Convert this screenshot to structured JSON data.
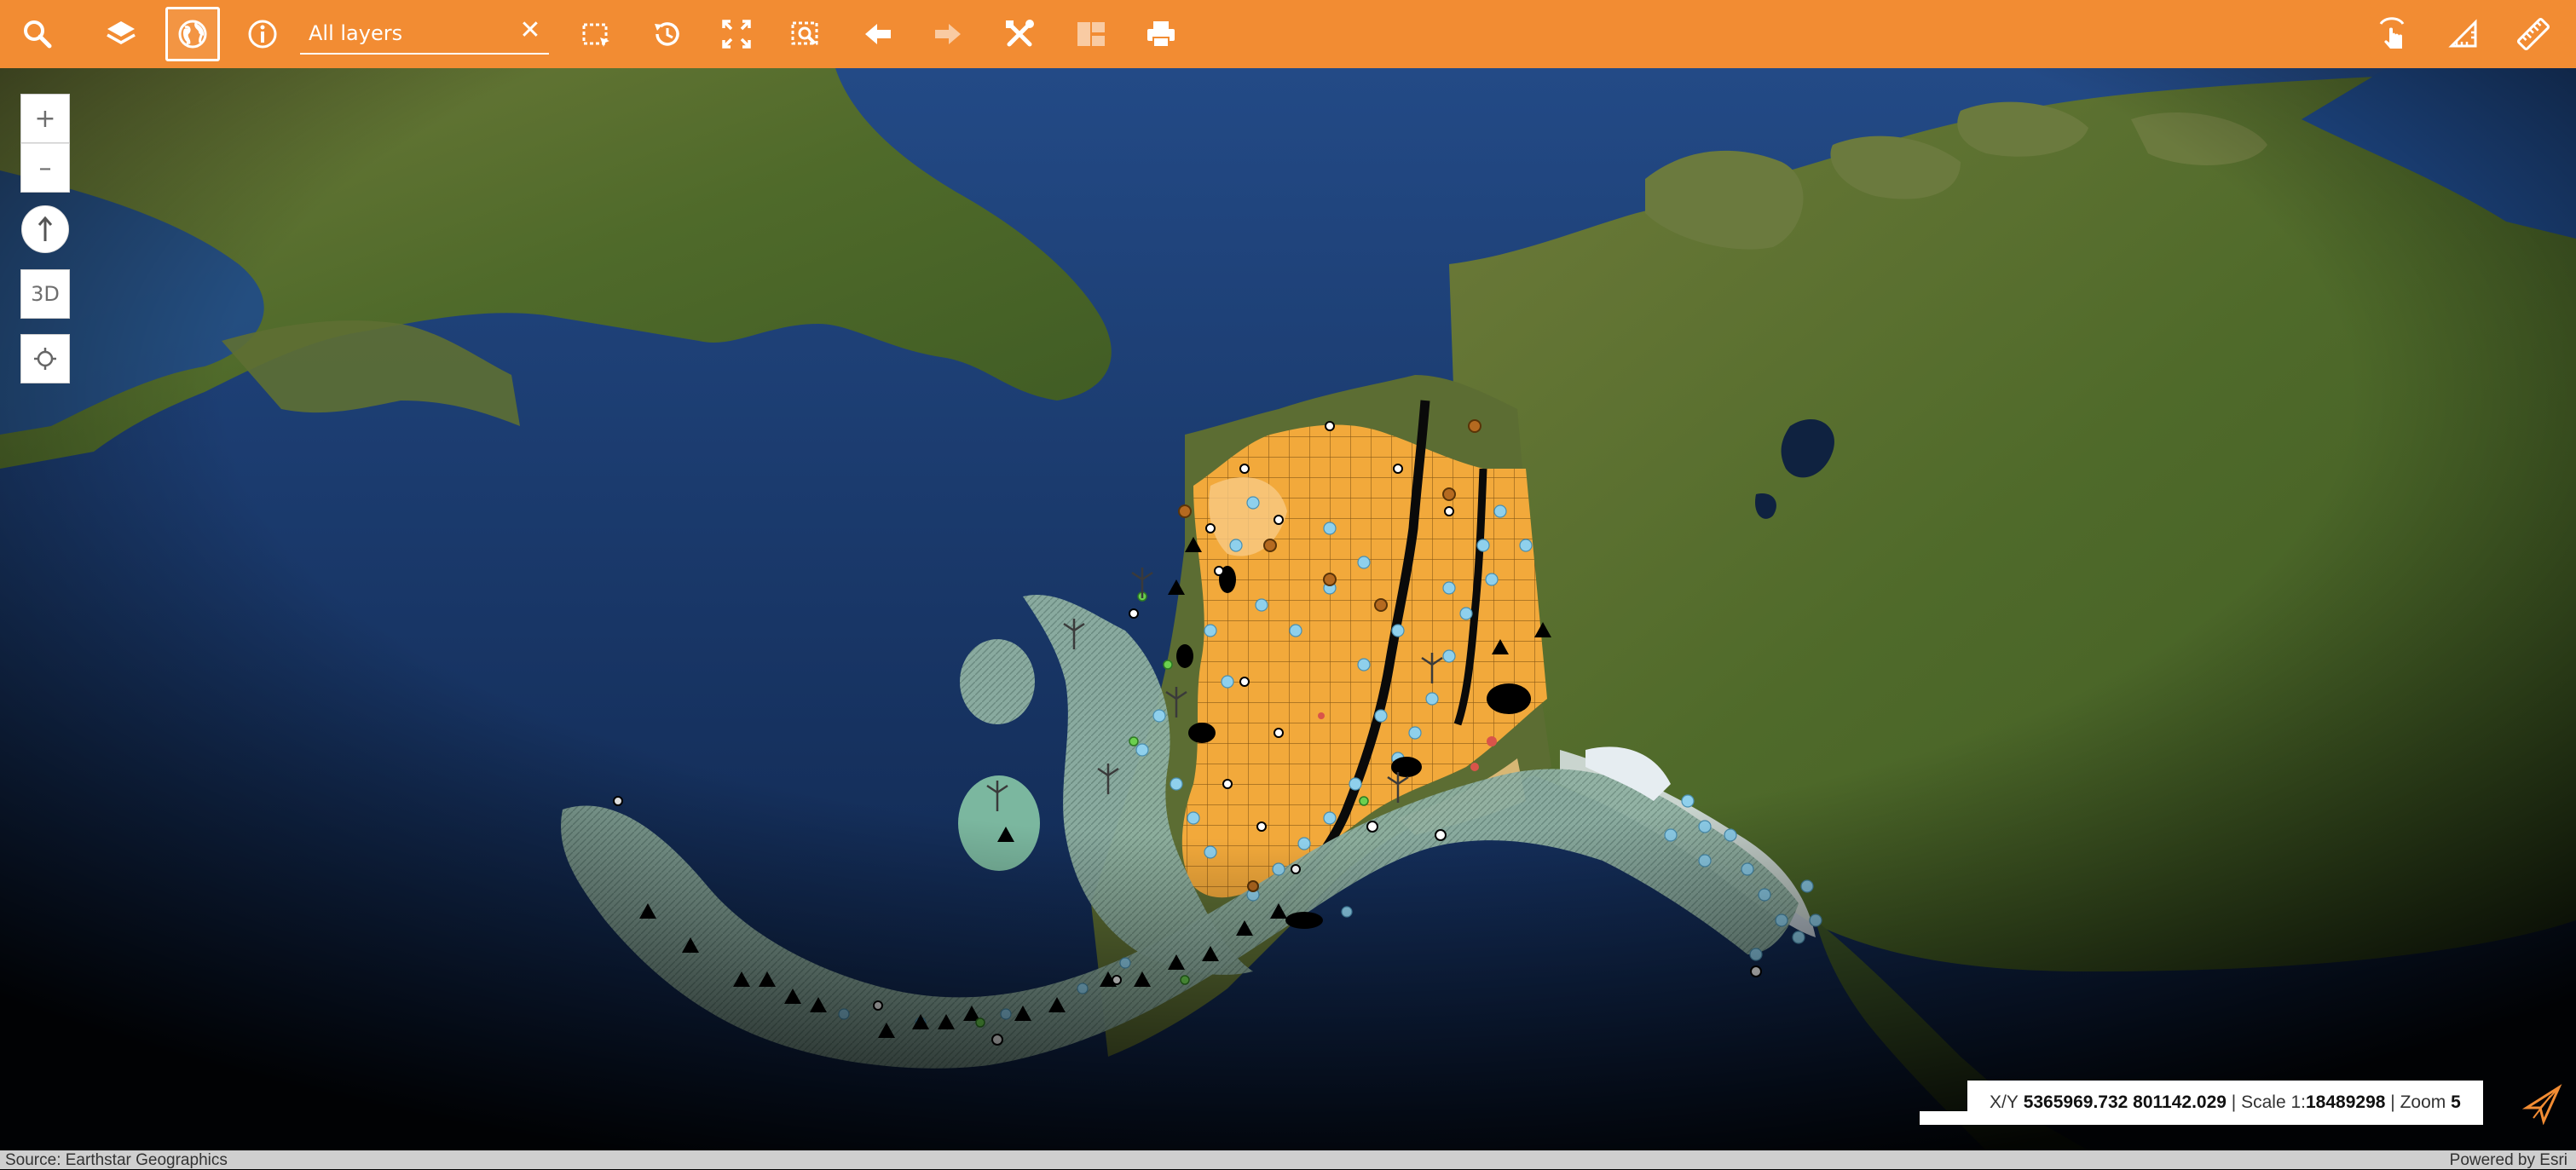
{
  "toolbar": {
    "background_color": "#f28c33",
    "search": {
      "placeholder": "All layers",
      "value": ""
    },
    "buttons_left": [
      {
        "icon": "search-icon"
      },
      {
        "icon": "layers-icon"
      },
      {
        "icon": "globe-icon",
        "active": true
      },
      {
        "icon": "info-icon"
      }
    ],
    "buttons_after_search": [
      {
        "icon": "select-rectangle-icon"
      },
      {
        "icon": "history-icon"
      },
      {
        "icon": "full-extent-icon"
      },
      {
        "icon": "zoom-to-selection-icon"
      },
      {
        "icon": "arrow-left-icon"
      },
      {
        "icon": "arrow-right-icon",
        "disabled": true
      },
      {
        "icon": "tools-icon"
      },
      {
        "icon": "map-gallery-icon",
        "disabled": true
      },
      {
        "icon": "print-icon"
      }
    ],
    "buttons_right": [
      {
        "icon": "touch-identify-icon"
      },
      {
        "icon": "measure-area-icon"
      },
      {
        "icon": "ruler-icon"
      }
    ]
  },
  "map_controls": {
    "zoom_in": "+",
    "zoom_out": "–",
    "three_d": "3D"
  },
  "status": {
    "xy_label": "X/Y",
    "xy_value": "5365969.732 801142.029",
    "scale_label": "Scale 1:",
    "scale_value": "18489298",
    "zoom_label": "Zoom",
    "zoom_value": "5",
    "separator": "|"
  },
  "attribution": {
    "source": "Source: Earthstar Geographics",
    "powered_by": "Powered by Esri"
  },
  "colors": {
    "ocean": "#1c3f73",
    "land": "#586c32",
    "alaska_fill": "#f2a93b",
    "aleutian_buffer": "#7fa597",
    "points": "#8fd0ec"
  }
}
